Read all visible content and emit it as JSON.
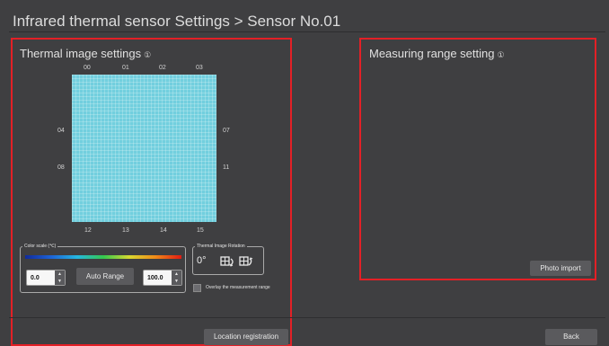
{
  "header": {
    "title": "Infrared thermal sensor Settings > Sensor No.01"
  },
  "thermal": {
    "title": "Thermal image settings",
    "info_icon": "①",
    "top_labels": [
      "00",
      "01",
      "02",
      "03"
    ],
    "left_labels": [
      "04",
      "08"
    ],
    "right_labels": [
      "07",
      "11"
    ],
    "bottom_labels": [
      "12",
      "13",
      "14",
      "15"
    ]
  },
  "color_scale": {
    "legend": "Color scale (℃)",
    "min_value": "0.0",
    "max_value": "100.0",
    "auto_range_label": "Auto Range",
    "gradient_colors": [
      "#102a9c",
      "#1d63d6",
      "#25b7e0",
      "#34c84e",
      "#d8d830",
      "#f08a18",
      "#e21a12"
    ]
  },
  "rotation": {
    "legend": "Thermal Image Rotation",
    "value": "0°"
  },
  "overlay": {
    "label": "Overlay the measurement range",
    "checked": false
  },
  "measuring": {
    "title": "Measuring range setting",
    "info_icon": "①",
    "photo_import_label": "Photo import"
  },
  "footer": {
    "location_registration_label": "Location registration",
    "back_label": "Back"
  },
  "colors": {
    "highlight": "#e32026",
    "thermal_fill": "#72cfde",
    "background": "#3f3f41"
  }
}
